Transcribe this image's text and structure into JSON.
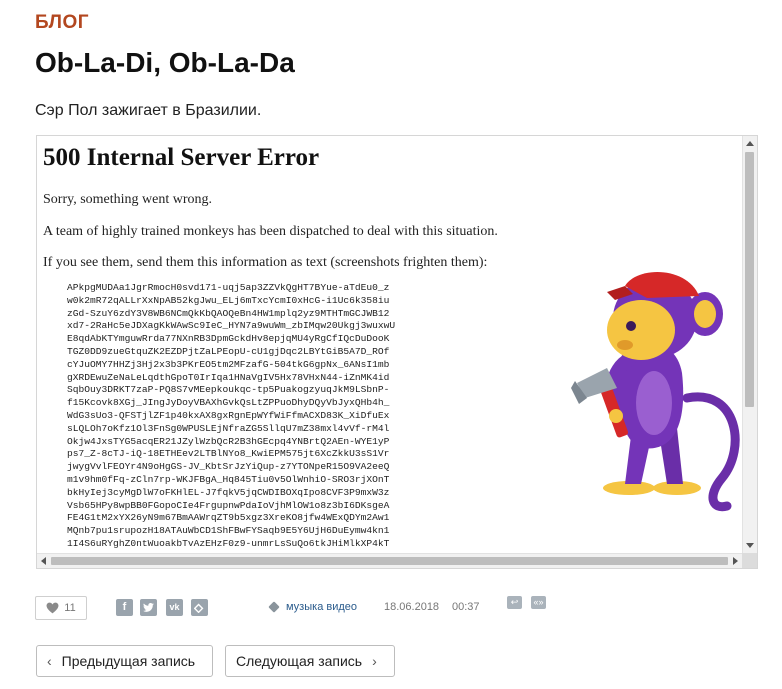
{
  "header": {
    "section": "БЛОГ",
    "title": "Ob-La-Di, Ob-La-Da",
    "subtitle": "Сэр Пол зажигает в Бразилии."
  },
  "embed": {
    "error_title": "500 Internal Server Error",
    "line1": "Sorry, something went wrong.",
    "line2": "A team of highly trained monkeys has been dispatched to deal with this situation.",
    "line3": "If you see them, send them this information as text (screenshots frighten them):",
    "code_lines": [
      "APkpgMUDAa1JgrRmocH0svd171-uqj5ap3ZZVkQgHT7BYue-aTdEu0_z",
      "w0k2mR72qALLrXxNpAB52kgJwu_ELj6mTxcYcmI0xHcG-i1Uc6k358iu",
      "zGd-SzuY6zdY3V8WB6NCmQkKbQAOQeBn4HW1mplq2yz9MTHTmGCJWB12",
      "xd7-2RaHc5eJDXagKkWAwSc9IeC_HYN7a9wuWm_zbIMqw20Ukgj3wuxwU",
      "E8qdAbKTYmguwRrda77NXnRB3DpmGckdHv8epjqMU4yRgCfIQcDuDooK",
      "TGZ0DD9zueGtquZK2EZDPjtZaLPEopU-cU1gjDqc2LBYtGiB5A7D_ROf",
      "cYJuOMY7HHZj3Hj2x3b3PKrEO5tm2MFzafG-504tkG6gpNx_6ANsI1mb",
      "gXRDEwuZeNaLeLqdthGpoT0IrIqa1HNaVgIV5Hx78VHxN44-iZnMK4id",
      "SqbOuy3DRKT7zaP-PQ8S7vMEepkoukqc-tp5PuakogzyuqJkM9LSbnP-",
      "f15Kcovk8XGj_JIngJyDoyVBAXhGvkQsLtZPPuoDhyDQyVbJyxQHb4h_",
      "WdG3sUo3-QFSTjlZF1p40kxAX8gxRgnEpWYfWiFfmACXD83K_XiDfuEx",
      "sLQLOh7oKfz1Ol3FnSg0WPUSLEjNfraZG5SllqU7mZ38mxl4vVf-rM4l",
      "Okjw4JxsTYG5acqER21JZylWzbQcR2B3hGEcpq4YNBrtQ2AEn-WYE1yP",
      "ps7_Z-8cTJ-iQ-18ETHEev2LTBlNYo8_KwiEPM575jt6XcZkkU3sS1Vr",
      "jwygVvlFEOYr4N9oHgGS-JV_KbtSrJzYiQup-z7YTONpeR15O9VA2eeQ",
      "m1v9hm0fFq-zCln7rp-WKJFBgA_Hq845Tiu0v5OlWnhiO-SRO3rjXOnT",
      "bkHyIej3cyMgDlW7oFKHlEL-J7fqkV5jqCWDIBOXqIpo8CVF3P9mxW3z",
      "Vsb65HPy8wpBB0FGopoCIe4FrgupnwPdaIoVjhMlOW1o8z3bI6DKsgeA",
      "FE4G1tM2xYX26yN9m67BmAAWrqZT9b5xgz3XreKO8jfw4WExQDYm2Aw1",
      "MQnb7pu1srupozH18ATAuWbCD1ShFBwFYSaqb9E5Y6UjH6DuEymw4kn1",
      "1I4S6uRYghZ0ntWuoakbTvAzEHzF0z9-unmrLsSuQo6tkJHiMlkXP4kT"
    ]
  },
  "footer": {
    "like_count": "11",
    "tags": "музыка видео",
    "date": "18.06.2018",
    "time": "00:37"
  },
  "navigation": {
    "prev_label": "Предыдущая запись",
    "next_label": "Следующая запись"
  },
  "colors": {
    "section_accent": "#b3471f",
    "link": "#2a5b8c",
    "share_icon": "#9aa4ad"
  }
}
